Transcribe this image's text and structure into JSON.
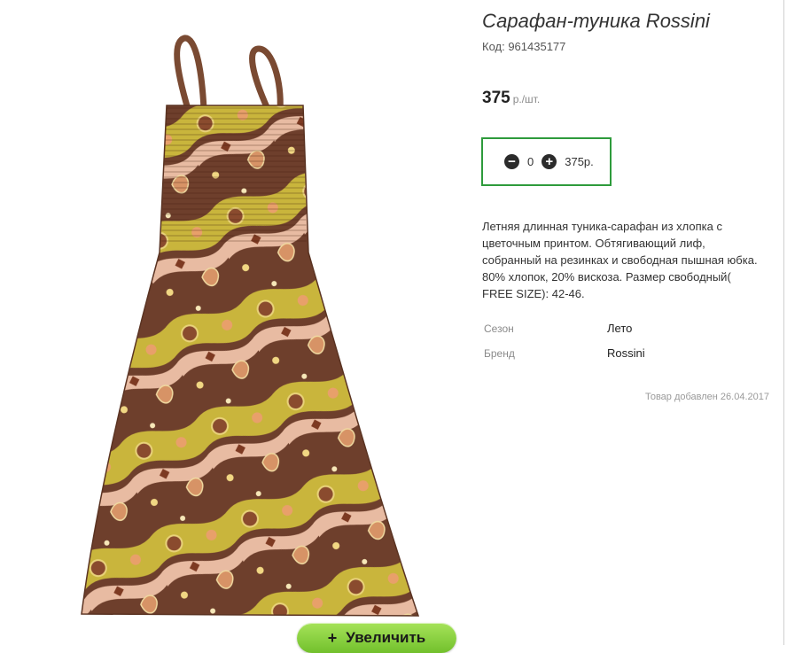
{
  "product": {
    "title": "Сарафан-туника Rossini",
    "code_label": "Код: 961435177",
    "price": "375",
    "price_unit": "р./шт.",
    "quantity": "0",
    "total": "375р.",
    "description": "Летняя длинная туника-сарафан из хлопка с цветочным принтом. Обтягивающий лиф, собранный на резинках и свободная пышная юбка. 80% хлопок, 20% вискоза. Размер свободный( FREE SIZE): 42-46.",
    "properties": [
      {
        "label": "Сезон",
        "value": "Лето"
      },
      {
        "label": "Бренд",
        "value": "Rossini"
      }
    ],
    "added": "Товар добавлен 26.04.2017"
  },
  "zoom_button": {
    "icon": "plus-icon",
    "label": "Увеличить"
  },
  "colors": {
    "accent_border": "#2e9b3c",
    "zoom_button": "#8fd43f",
    "dress_base": "#6b3f2a",
    "dress_yellow": "#c8b43a",
    "dress_pink": "#e7b7a0"
  }
}
